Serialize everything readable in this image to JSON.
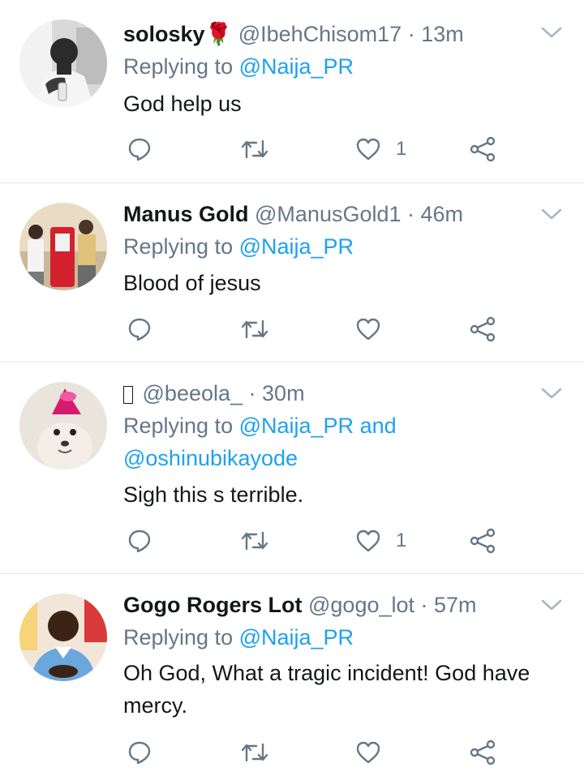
{
  "tweets": [
    {
      "name": "solosky🌹",
      "handle": "@IbehChisom17",
      "time": "· 13m",
      "replying_prefix": "Replying to ",
      "replying_to": "@Naija_PR",
      "replying_and": "",
      "replying_to_2": "",
      "text": "God help us",
      "like_count": "1"
    },
    {
      "name": "Manus Gold",
      "handle": "@ManusGold1",
      "time": "· 46m",
      "replying_prefix": "Replying to ",
      "replying_to": "@Naija_PR",
      "replying_and": "",
      "replying_to_2": "",
      "text": "Blood of jesus",
      "like_count": ""
    },
    {
      "name": "",
      "handle": "@beeola_",
      "time": "· 30m",
      "replying_prefix": "Replying to ",
      "replying_to": "@Naija_PR",
      "replying_and": " and",
      "replying_to_2": "@oshinubikayode",
      "text": "Sigh this s terrible.",
      "like_count": "1"
    },
    {
      "name": "Gogo Rogers Lot",
      "handle": "@gogo_lot",
      "time": "· 57m",
      "replying_prefix": "Replying to ",
      "replying_to": "@Naija_PR",
      "replying_and": "",
      "replying_to_2": "",
      "text": "Oh God, What a tragic incident! God have mercy.",
      "like_count": ""
    }
  ],
  "icons": {
    "reply": "reply-icon",
    "retweet": "retweet-icon",
    "like": "heart-icon",
    "share": "share-icon",
    "menu": "chevron-down-icon"
  },
  "colors": {
    "link": "#1da1f2",
    "secondary_text": "#657786",
    "primary_text": "#14171a",
    "divider": "#e1e8ed"
  }
}
